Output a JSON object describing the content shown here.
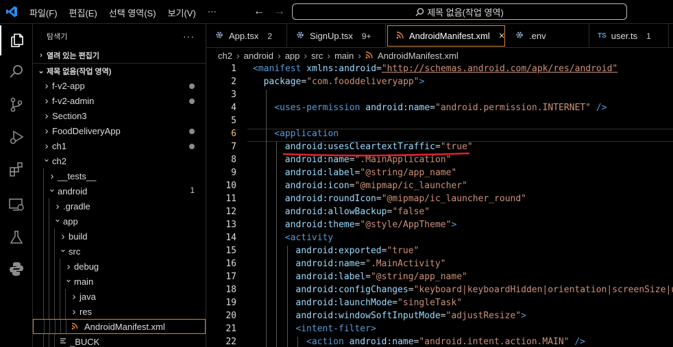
{
  "titlebar": {
    "menu": [
      "파일(F)",
      "편집(E)",
      "선택 영역(S)",
      "보기(V)",
      "···"
    ],
    "search_text": "제목 없음(작업 영역)"
  },
  "activity_icons": [
    "explorer-icon",
    "search-icon",
    "source-control-icon",
    "run-debug-icon",
    "extensions-icon",
    "remote-explorer-icon",
    "testing-icon",
    "python-icon"
  ],
  "sidebar": {
    "title": "탐색기",
    "more": "···",
    "open_editors": "열려 있는 편집기",
    "workspace": "제목 없음(작업 영역)",
    "items": [
      {
        "label": "f-v2-app",
        "depth": 0,
        "expanded": false,
        "dot": true
      },
      {
        "label": "f-v2-admin",
        "depth": 0,
        "expanded": false,
        "dot": true
      },
      {
        "label": "Section3",
        "depth": 0,
        "expanded": false
      },
      {
        "label": "FoodDeliveryApp",
        "depth": 0,
        "expanded": false,
        "dot": true
      },
      {
        "label": "ch1",
        "depth": 0,
        "expanded": false,
        "dot": true
      },
      {
        "label": "ch2",
        "depth": 0,
        "expanded": true
      },
      {
        "label": "__tests__",
        "depth": 1,
        "expanded": false
      },
      {
        "label": "android",
        "depth": 1,
        "expanded": true,
        "badge": "1"
      },
      {
        "label": ".gradle",
        "depth": 2,
        "expanded": false
      },
      {
        "label": "app",
        "depth": 2,
        "expanded": true
      },
      {
        "label": "build",
        "depth": 3,
        "expanded": false
      },
      {
        "label": "src",
        "depth": 3,
        "expanded": true
      },
      {
        "label": "debug",
        "depth": 4,
        "expanded": false
      },
      {
        "label": "main",
        "depth": 4,
        "expanded": true
      },
      {
        "label": "java",
        "depth": 5,
        "expanded": false
      },
      {
        "label": "res",
        "depth": 5,
        "expanded": false
      },
      {
        "label": "AndroidManifest.xml",
        "depth": 5,
        "file": "xml",
        "selected": true
      },
      {
        "label": "_BUCK",
        "depth": 3,
        "file": "text"
      }
    ]
  },
  "tabs": [
    {
      "label": "App.tsx",
      "count": "2",
      "icon": "gear-icon"
    },
    {
      "label": "SignUp.tsx",
      "count": "9+",
      "icon": "gear-icon"
    },
    {
      "label": "AndroidManifest.xml",
      "icon": "rss-icon",
      "active": true,
      "close": "×"
    },
    {
      "label": ".env",
      "icon": "gear-icon"
    },
    {
      "label": "user.ts",
      "count": "1",
      "icon": "TS"
    }
  ],
  "breadcrumb": [
    "ch2",
    "android",
    "app",
    "src",
    "main",
    "AndroidManifest.xml"
  ],
  "editor": {
    "current_line": 6,
    "lines": [
      {
        "n": "1",
        "indent": 0,
        "tokens": [
          [
            "tag",
            "<manifest"
          ],
          [
            "sp",
            " "
          ],
          [
            "attr",
            "xmlns:android"
          ],
          [
            "eq",
            "="
          ],
          [
            "link",
            "\"http://schemas.android.com/apk/res/android\""
          ]
        ]
      },
      {
        "n": "2",
        "indent": 1,
        "tokens": [
          [
            "attr",
            "package"
          ],
          [
            "eq",
            "="
          ],
          [
            "str",
            "\"com.fooddeliveryapp\""
          ],
          [
            "tag",
            ">"
          ]
        ]
      },
      {
        "n": "3",
        "indent": 0,
        "tokens": []
      },
      {
        "n": "4",
        "indent": 2,
        "tokens": [
          [
            "tag",
            "<uses-permission"
          ],
          [
            "sp",
            " "
          ],
          [
            "attr",
            "android:name"
          ],
          [
            "eq",
            "="
          ],
          [
            "str",
            "\"android.permission.INTERNET\""
          ],
          [
            "sp",
            " "
          ],
          [
            "tag",
            "/>"
          ]
        ]
      },
      {
        "n": "5",
        "indent": 0,
        "tokens": []
      },
      {
        "n": "6",
        "indent": 2,
        "tokens": [
          [
            "tag",
            "<application"
          ]
        ]
      },
      {
        "n": "7",
        "indent": 3,
        "tokens": [
          [
            "attr",
            "android:usesCleartextTraffic"
          ],
          [
            "eq",
            "="
          ],
          [
            "str",
            "\"true\""
          ]
        ]
      },
      {
        "n": "8",
        "indent": 3,
        "tokens": [
          [
            "attr",
            "android:name"
          ],
          [
            "eq",
            "="
          ],
          [
            "str",
            "\".MainApplication\""
          ]
        ]
      },
      {
        "n": "9",
        "indent": 3,
        "tokens": [
          [
            "attr",
            "android:label"
          ],
          [
            "eq",
            "="
          ],
          [
            "str",
            "\"@string/app_name\""
          ]
        ]
      },
      {
        "n": "10",
        "indent": 3,
        "tokens": [
          [
            "attr",
            "android:icon"
          ],
          [
            "eq",
            "="
          ],
          [
            "str",
            "\"@mipmap/ic_launcher\""
          ]
        ]
      },
      {
        "n": "11",
        "indent": 3,
        "tokens": [
          [
            "attr",
            "android:roundIcon"
          ],
          [
            "eq",
            "="
          ],
          [
            "str",
            "\"@mipmap/ic_launcher_round\""
          ]
        ]
      },
      {
        "n": "12",
        "indent": 3,
        "tokens": [
          [
            "attr",
            "android:allowBackup"
          ],
          [
            "eq",
            "="
          ],
          [
            "str",
            "\"false\""
          ]
        ]
      },
      {
        "n": "13",
        "indent": 3,
        "tokens": [
          [
            "attr",
            "android:theme"
          ],
          [
            "eq",
            "="
          ],
          [
            "str",
            "\"@style/AppTheme\""
          ],
          [
            "tag",
            ">"
          ]
        ]
      },
      {
        "n": "14",
        "indent": 3,
        "tokens": [
          [
            "tag",
            "<activity"
          ]
        ]
      },
      {
        "n": "15",
        "indent": 4,
        "tokens": [
          [
            "attr",
            "android:exported"
          ],
          [
            "eq",
            "="
          ],
          [
            "str",
            "\"true\""
          ]
        ]
      },
      {
        "n": "16",
        "indent": 4,
        "tokens": [
          [
            "attr",
            "android:name"
          ],
          [
            "eq",
            "="
          ],
          [
            "str",
            "\".MainActivity\""
          ]
        ]
      },
      {
        "n": "17",
        "indent": 4,
        "tokens": [
          [
            "attr",
            "android:label"
          ],
          [
            "eq",
            "="
          ],
          [
            "str",
            "\"@string/app_name\""
          ]
        ]
      },
      {
        "n": "18",
        "indent": 4,
        "tokens": [
          [
            "attr",
            "android:configChanges"
          ],
          [
            "eq",
            "="
          ],
          [
            "str",
            "\"keyboard|keyboardHidden|orientation|screenSize|ui"
          ]
        ]
      },
      {
        "n": "19",
        "indent": 4,
        "tokens": [
          [
            "attr",
            "android:launchMode"
          ],
          [
            "eq",
            "="
          ],
          [
            "str",
            "\"singleTask\""
          ]
        ]
      },
      {
        "n": "20",
        "indent": 4,
        "tokens": [
          [
            "attr",
            "android:windowSoftInputMode"
          ],
          [
            "eq",
            "="
          ],
          [
            "str",
            "\"adjustResize\""
          ],
          [
            "tag",
            ">"
          ]
        ]
      },
      {
        "n": "21",
        "indent": 4,
        "tokens": [
          [
            "tag",
            "<intent-filter"
          ],
          [
            "tag",
            ">"
          ]
        ]
      },
      {
        "n": "22",
        "indent": 5,
        "tokens": [
          [
            "tag",
            "<action"
          ],
          [
            "sp",
            " "
          ],
          [
            "attr",
            "android:name"
          ],
          [
            "eq",
            "="
          ],
          [
            "str",
            "\"android.intent.action.MAIN\""
          ],
          [
            "sp",
            " "
          ],
          [
            "tag",
            "/>"
          ]
        ]
      }
    ]
  },
  "colors": {
    "accent": "#d48a33",
    "annotation": "#e0232d",
    "tag": "#569cd6",
    "attribute": "#9cdcfe",
    "string": "#ce9178"
  }
}
